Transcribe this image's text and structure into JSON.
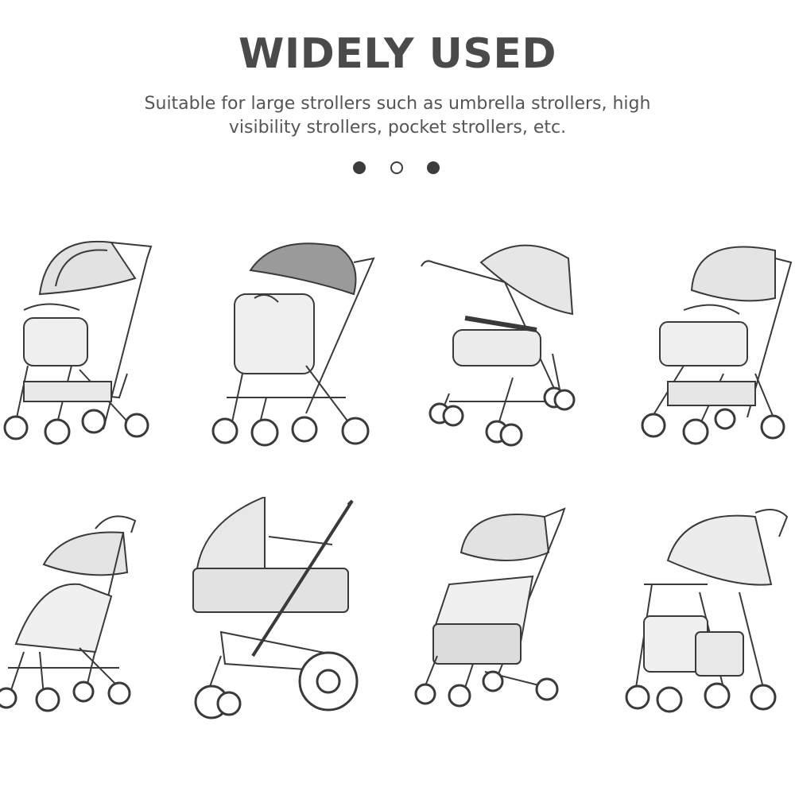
{
  "header": {
    "title": "WIDELY USED",
    "subtitle": "Suitable for large strollers such as umbrella strollers, high visibility strollers, pocket strollers, etc."
  },
  "indicator": {
    "count": 3,
    "active_index": 1
  },
  "gallery": {
    "rows": 2,
    "columns": 4,
    "items": [
      {
        "icon": "stroller-sketch-icon"
      },
      {
        "icon": "stroller-sketch-icon"
      },
      {
        "icon": "stroller-sketch-icon"
      },
      {
        "icon": "stroller-sketch-icon"
      },
      {
        "icon": "stroller-sketch-icon"
      },
      {
        "icon": "pram-sketch-icon"
      },
      {
        "icon": "stroller-sketch-icon"
      },
      {
        "icon": "stroller-sketch-icon"
      }
    ]
  },
  "colors": {
    "title": "#4a4a4a",
    "text": "#555555",
    "sketch": "#3a3a3a",
    "background": "#ffffff"
  }
}
